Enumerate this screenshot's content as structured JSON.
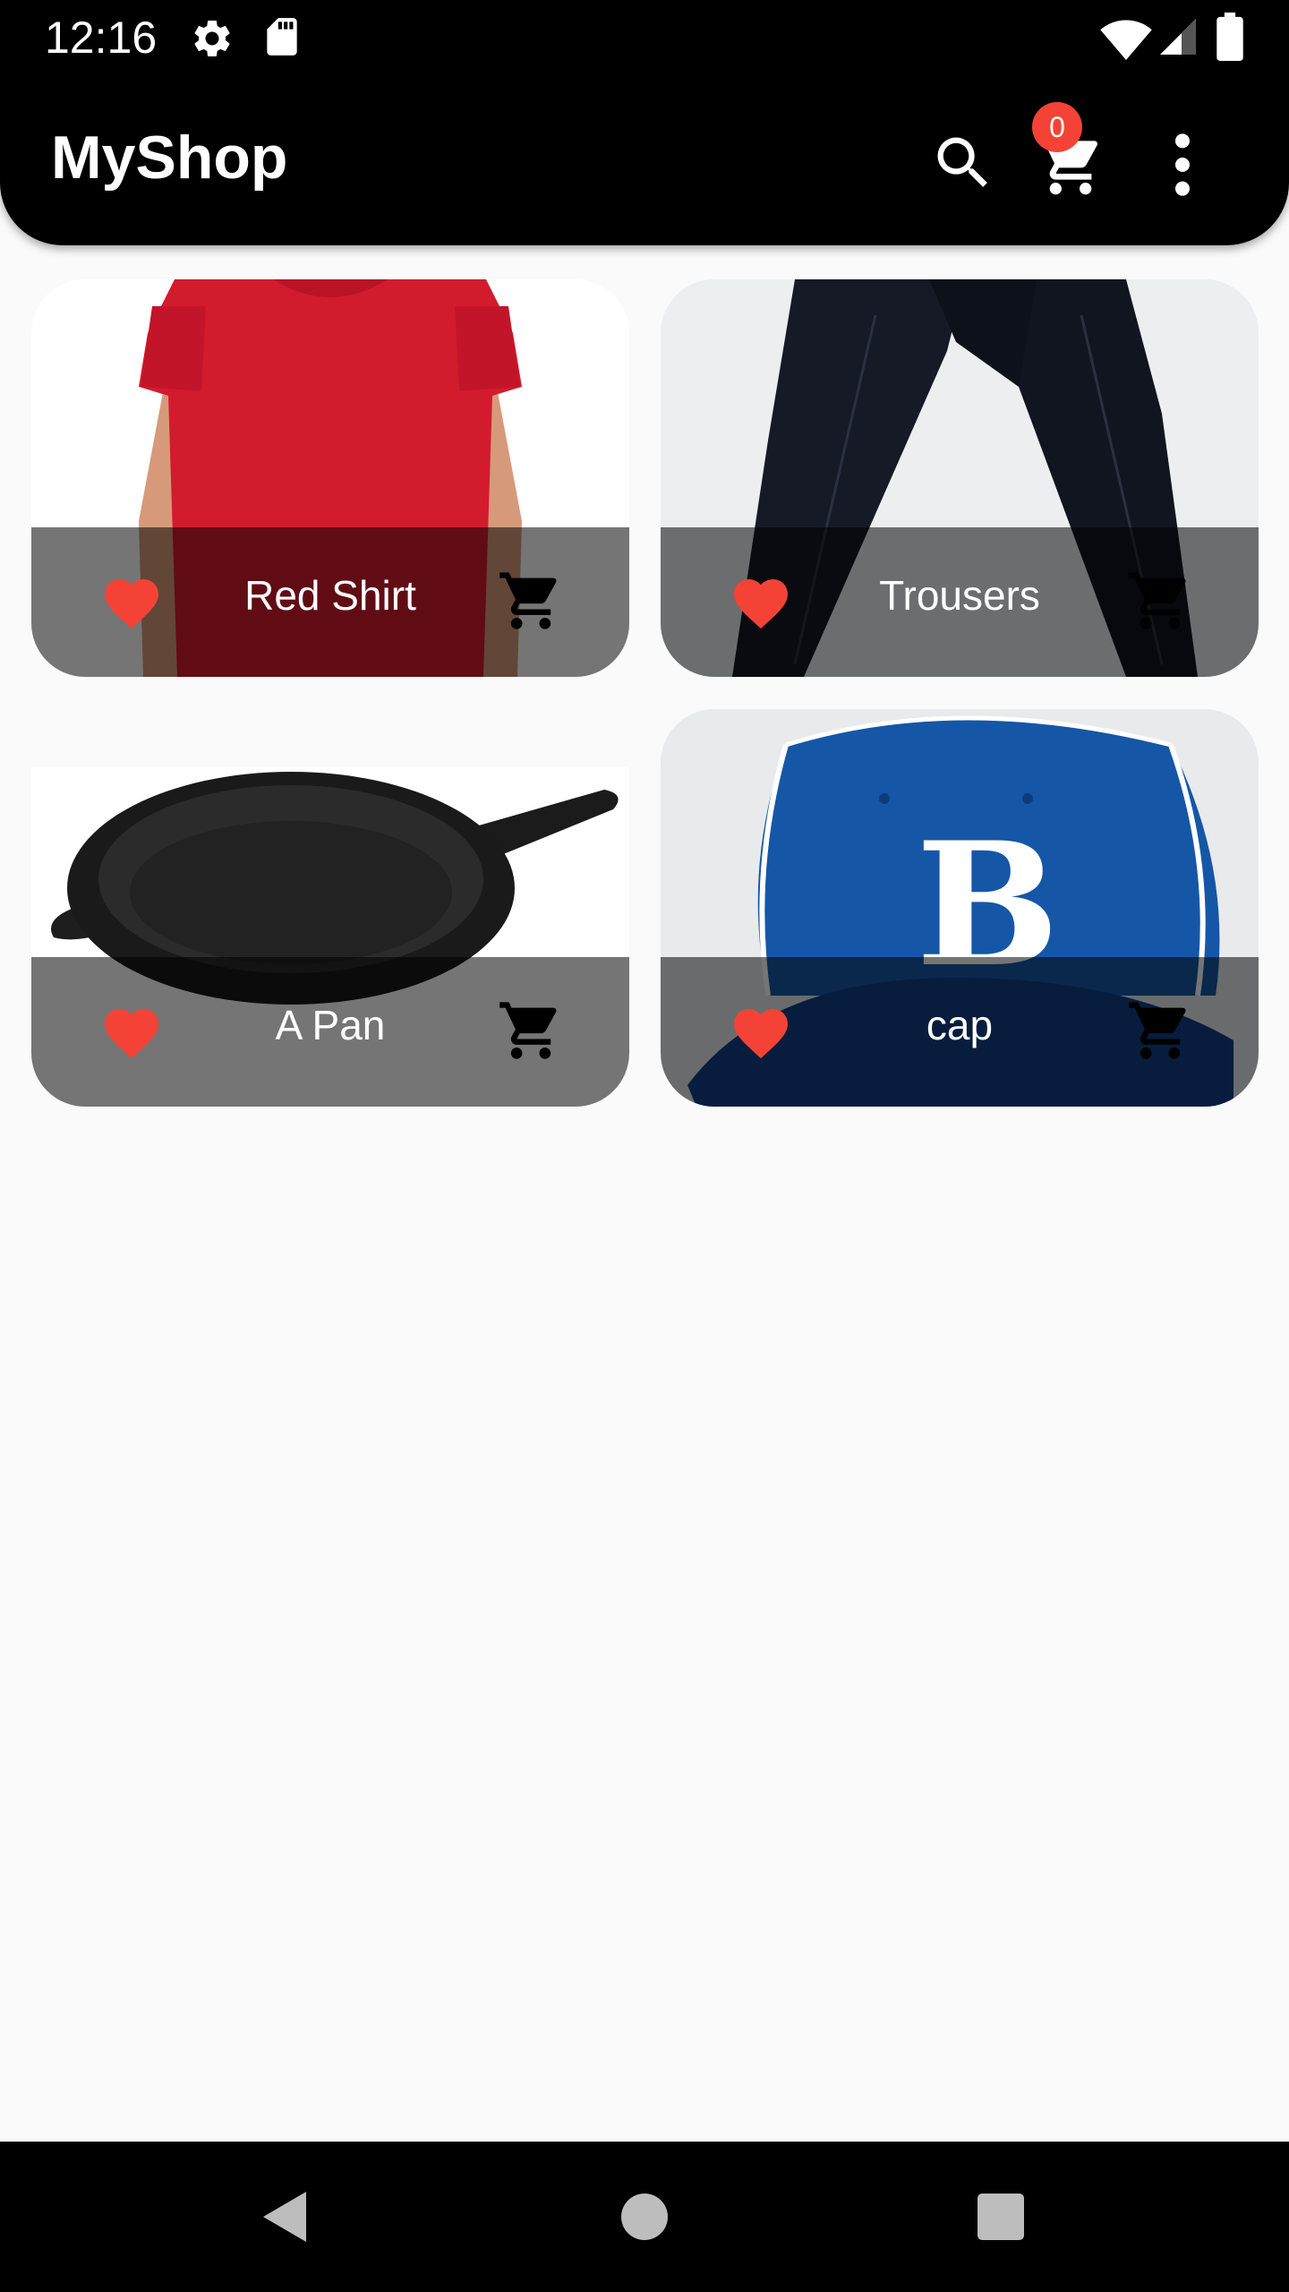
{
  "status_bar": {
    "time": "12:16",
    "icons": [
      "gear-icon",
      "sd-card-icon",
      "wifi-icon",
      "signal-icon",
      "battery-icon"
    ]
  },
  "app_bar": {
    "title": "MyShop",
    "cart_count": "0",
    "actions": [
      "search-icon",
      "cart-icon",
      "more-vert-icon"
    ]
  },
  "products": [
    {
      "title": "Red Shirt",
      "image": "red-shirt-photo",
      "favorite": true
    },
    {
      "title": "Trousers",
      "image": "trousers-photo",
      "favorite": true
    },
    {
      "title": "A Pan",
      "image": "pan-photo",
      "favorite": true
    },
    {
      "title": "cap",
      "image": "cap-photo",
      "favorite": true
    }
  ],
  "colors": {
    "favorite": "#f44336",
    "badge": "#f44336",
    "bar_background": "#000000",
    "page_background": "#fafafa"
  },
  "nav_bar": {
    "buttons": [
      "back-icon",
      "home-icon",
      "recents-icon"
    ]
  }
}
